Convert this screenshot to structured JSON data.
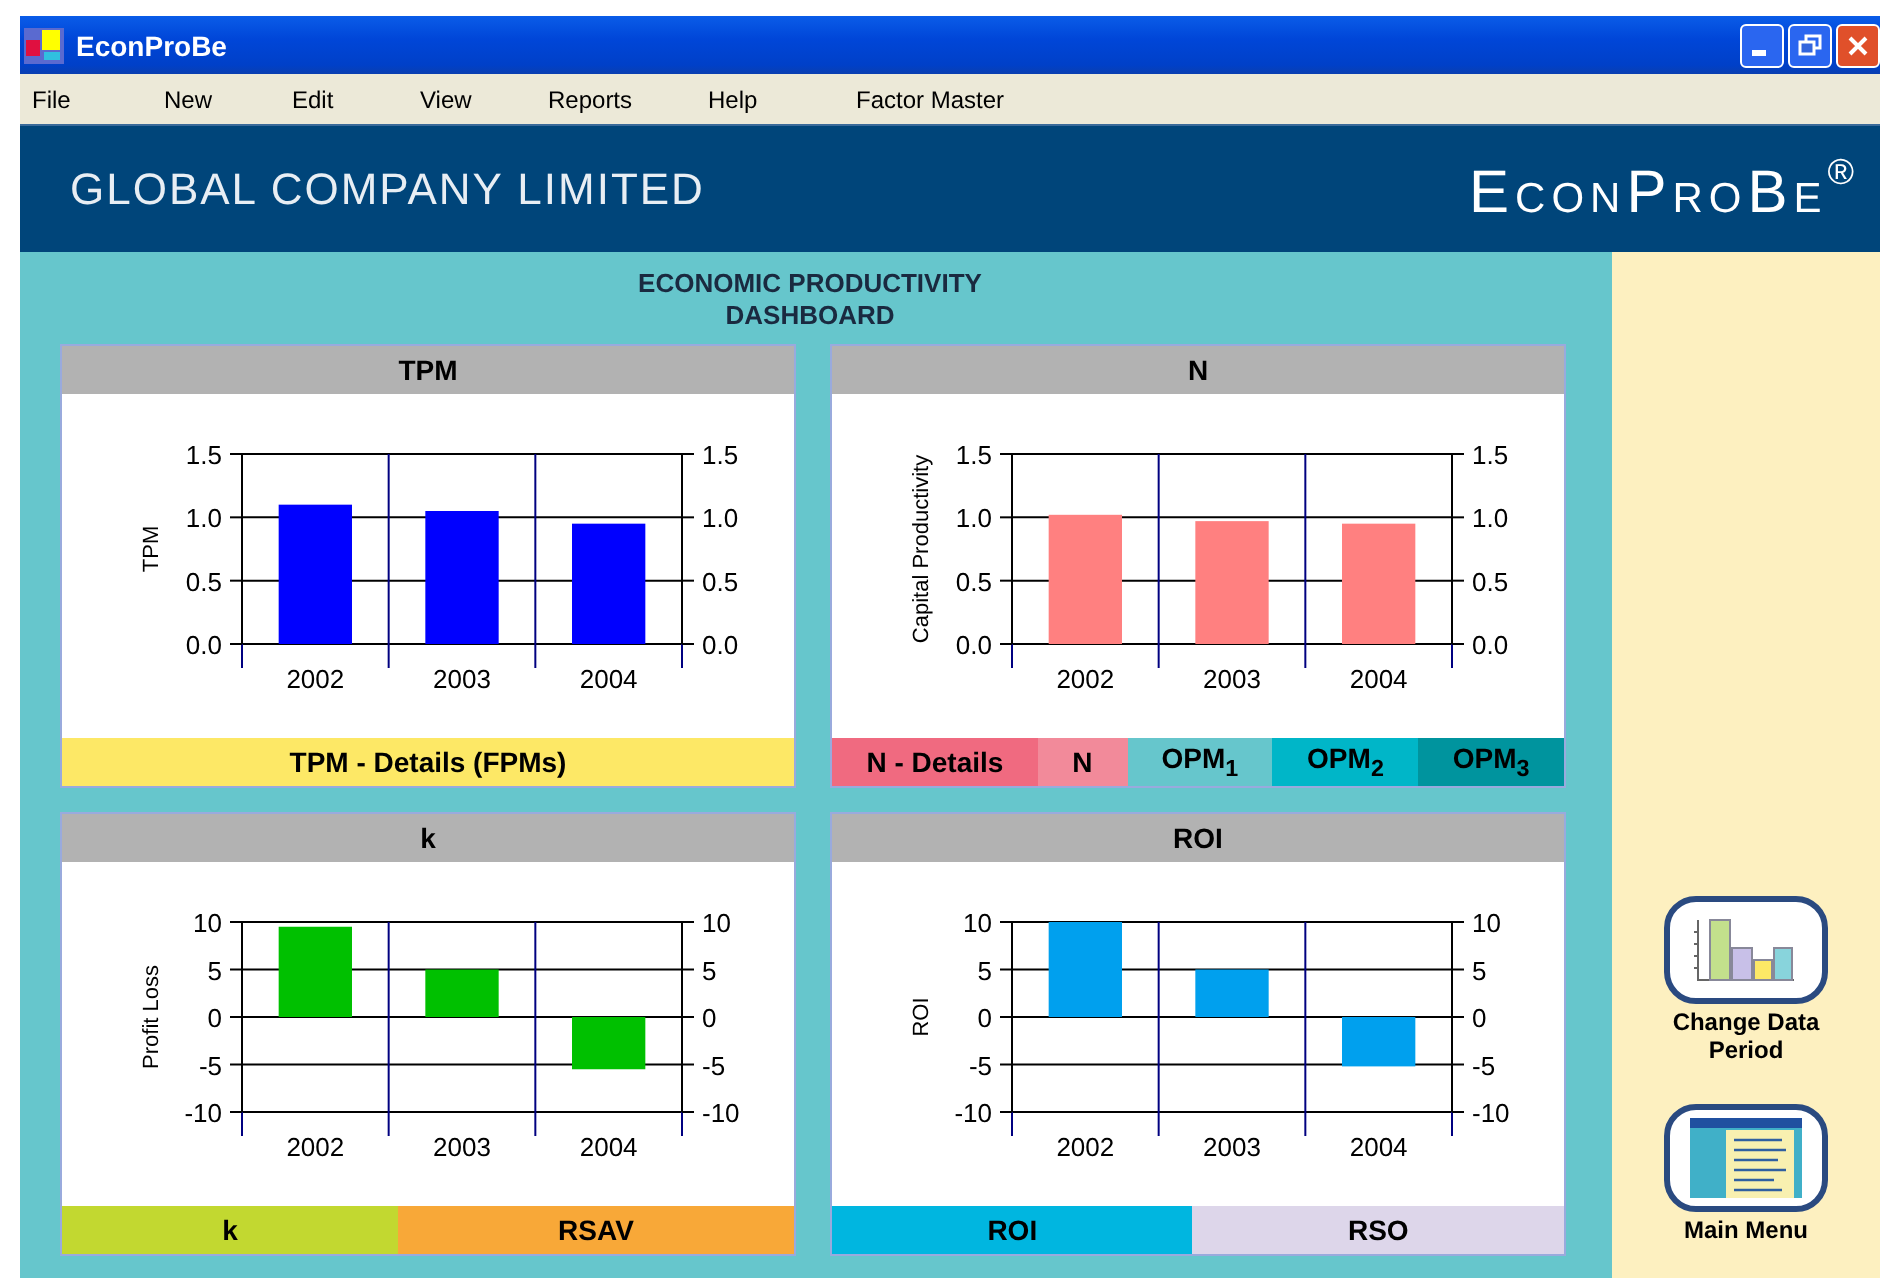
{
  "window": {
    "title": "EconProBe"
  },
  "menu": [
    "File",
    "New",
    "Edit",
    "View",
    "Reports",
    "Help",
    "Factor Master"
  ],
  "header": {
    "company": "GLOBAL COMPANY LIMITED",
    "logo": "EconProBe$^{®}$"
  },
  "dashboard": {
    "title_lines": [
      "ECONOMIC PRODUCTIVITY",
      "DASHBOARD"
    ]
  },
  "panels": [
    {
      "title": "TPM",
      "chart_data": {
        "type": "bar",
        "ylabel": "TPM",
        "grid": true,
        "categories": [
          "2002",
          "2003",
          "2004"
        ],
        "series": [
          {
            "color": "#0000ff",
            "values": [
              1.1,
              1.05,
              0.95
            ]
          }
        ],
        "ylim": [
          0,
          1.5
        ],
        "yticks": [
          {
            "value": 0,
            "label": "0.0"
          },
          {
            "value": 0.5,
            "label": "0.5"
          },
          {
            "value": 1,
            "label": "1.0"
          },
          {
            "value": 1.5,
            "label": "1.5"
          }
        ]
      },
      "buttons": [
        {
          "label": "TPM - Details (FPMs)",
          "color": "#fde866"
        }
      ]
    },
    {
      "title": "N",
      "chart_data": {
        "type": "bar",
        "ylabel": "Capital Productivity",
        "grid": true,
        "categories": [
          "2002",
          "2003",
          "2004"
        ],
        "series": [
          {
            "color": "#ff8080",
            "values": [
              1.02,
              0.97,
              0.95
            ]
          }
        ],
        "ylim": [
          0,
          1.5
        ],
        "yticks": [
          {
            "value": 0,
            "label": "0.0"
          },
          {
            "value": 0.5,
            "label": "0.5"
          },
          {
            "value": 1,
            "label": "1.0"
          },
          {
            "value": 1.5,
            "label": "1.5"
          }
        ]
      },
      "buttons": [
        {
          "label": "N - Details",
          "color": "#f06a80"
        },
        {
          "label": "N",
          "color": "#f28a9a"
        },
        {
          "label": "OPM$_{1}$",
          "color": "#66c6cc"
        },
        {
          "label": "OPM$_{2}$",
          "color": "#00b6c8"
        },
        {
          "label": "OPM$_{3}$",
          "color": "#00949e"
        }
      ]
    },
    {
      "title": "k",
      "chart_data": {
        "type": "bar",
        "ylabel": "Profit Loss",
        "categories": [
          "2002",
          "2003",
          "2004"
        ],
        "grid": true,
        "series": [
          {
            "color": "#00c000",
            "values": [
              9.5,
              5,
              -5.5
            ]
          }
        ],
        "ylim": [
          -10,
          10
        ],
        "yticks": [
          {
            "value": -10,
            "label": "-10"
          },
          {
            "value": -5,
            "label": "-5"
          },
          {
            "value": 0,
            "label": "0"
          },
          {
            "value": 5,
            "label": "5"
          },
          {
            "value": 10,
            "label": "10"
          }
        ]
      },
      "buttons": [
        {
          "label": "k",
          "color": "#c2d830"
        },
        {
          "label": "RSAV",
          "color": "#f8a838"
        }
      ]
    },
    {
      "title": "ROI",
      "chart_data": {
        "type": "bar",
        "ylabel": "ROI",
        "categories": [
          "2002",
          "2003",
          "2004"
        ],
        "grid": true,
        "series": [
          {
            "color": "#00a0ee",
            "values": [
              10,
              5,
              -5.2
            ]
          }
        ],
        "ylim": [
          -10,
          10
        ],
        "yticks": [
          {
            "value": -10,
            "label": "-10"
          },
          {
            "value": -5,
            "label": "-5"
          },
          {
            "value": 0,
            "label": "0"
          },
          {
            "value": 5,
            "label": "5"
          },
          {
            "value": 10,
            "label": "10"
          }
        ]
      },
      "buttons": [
        {
          "label": "ROI",
          "color": "#00b6e0"
        },
        {
          "label": "RSO",
          "color": "#ddd6ea"
        }
      ]
    }
  ],
  "sidebar": {
    "buttons": [
      {
        "label": "Change Data Period",
        "kind": "chart"
      },
      {
        "label": "Main Menu",
        "kind": "document"
      }
    ]
  }
}
